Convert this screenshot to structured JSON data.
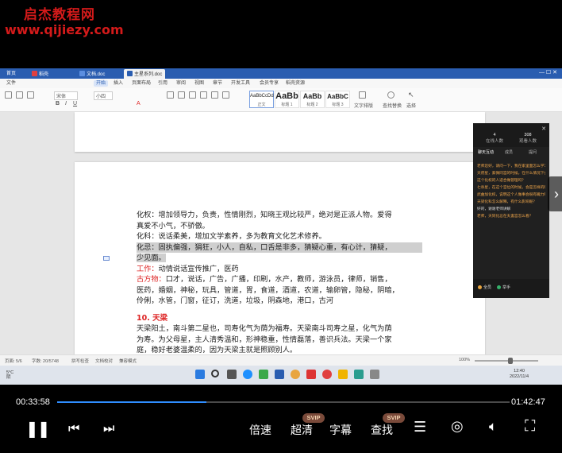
{
  "watermark": {
    "title": "启杰教程网",
    "url": "www.qijiezy.com"
  },
  "tabs": [
    {
      "label": "首页",
      "color": "#2a5db0"
    },
    {
      "label": "稻壳",
      "color": "#e04040"
    },
    {
      "label": "文档.doc",
      "color": "#2a5db0"
    },
    {
      "label": "主星系列.doc",
      "color": "#2a5db0"
    }
  ],
  "menu": {
    "items": [
      "文件",
      "开始",
      "插入",
      "页面布局",
      "引用",
      "审阅",
      "视图",
      "章节",
      "开发工具",
      "会员专享",
      "稻壳资源"
    ],
    "selected": "开始"
  },
  "ribbon": {
    "font_name": "宋体",
    "font_size": "小四",
    "styles": [
      {
        "preview": "AaBbCcDd",
        "name": "正文"
      },
      {
        "preview": "AaBb",
        "name": "标题 1"
      },
      {
        "preview": "AaBb",
        "name": "标题 2"
      },
      {
        "preview": "AaBbC",
        "name": "标题 3"
      }
    ],
    "right_tools": [
      "文字排版",
      "查找替换",
      "选择"
    ]
  },
  "document": {
    "lines": [
      "化权：增加领导力，负责，性情刚烈，知晓王观比较严，绝对是正派人物。爱得",
      "真爱不小气，不骄傲。",
      "化科：说话柔美，增加文学素养，多为教育文化艺术修养。",
      "化忌：固执偏强，狷狂，小人，自私，口舌是非多，猜疑心重，有心计，猜疑，",
      "少见面。"
    ],
    "work_label": "工作：",
    "work_text": "动情说话宣传推广，医药",
    "ancient_label": "古方物：",
    "ancient_lines": [
      "口才，说话，广告，广播，印刷，水产，教师，游泳员，律师，销售，",
      "医药，婚姻，神秘，玩具，管道，胃，食道，酒道，农道，输卵管，隐秘，阴暗，",
      "伶俐，水管，门窗，征订，洗道，垃圾，阴森地，港口，古河"
    ],
    "section_title": "10. 天梁",
    "section_lines": [
      "天梁阳土，南斗第二星也，司寿化气为荫为福寿。天梁南斗司寿之星，化气为荫",
      "为寿。为父母星，主人清秀温和，形神稳重，性情磊落，善识兵法。天梁一个家",
      "庭，稳好老婆温柔的，因为天梁主就是照顾别人。"
    ]
  },
  "side_panel": {
    "stats": [
      {
        "value": "4",
        "label": "在线人数"
      },
      {
        "value": "308",
        "label": "观看人数"
      }
    ],
    "tabs": [
      "聊天互动",
      "成员",
      "提问"
    ],
    "messages": [
      "老师您好，请问一下，我在家里面怎么学习好？",
      "天府星，紫微同宫的时候，在什么情况下会是好的？",
      "这个化权的人适合做管理吗？",
      "七杀星，在这个宫位的时候，会是怎样的呢？",
      "武曲加化权，说明这个人做事会很有魄力吗？",
      "天梁化科怎么解释，有什么影响呢？",
      "好的，谢谢老师讲解",
      "老师，天同化忌在夫妻宫怎么看？"
    ],
    "bottom": [
      "全员",
      "举手"
    ]
  },
  "statusbar": {
    "page": "页面: 5/6",
    "words": "字数: 20/5748",
    "spell": "拼写检查",
    "check": "文档校对",
    "mode": "兼容模式",
    "zoom": "100%"
  },
  "taskbar": {
    "weather_temp": "5°C",
    "weather_desc": "阴",
    "time": "12:40",
    "date": "2022/11/4"
  },
  "player": {
    "current_time": "00:33:58",
    "total_time": "01:42:47",
    "progress": 0.33,
    "speed_label": "倍速",
    "quality_label": "超清",
    "subtitle_label": "字幕",
    "search_label": "查找",
    "badge": "SVIP"
  }
}
